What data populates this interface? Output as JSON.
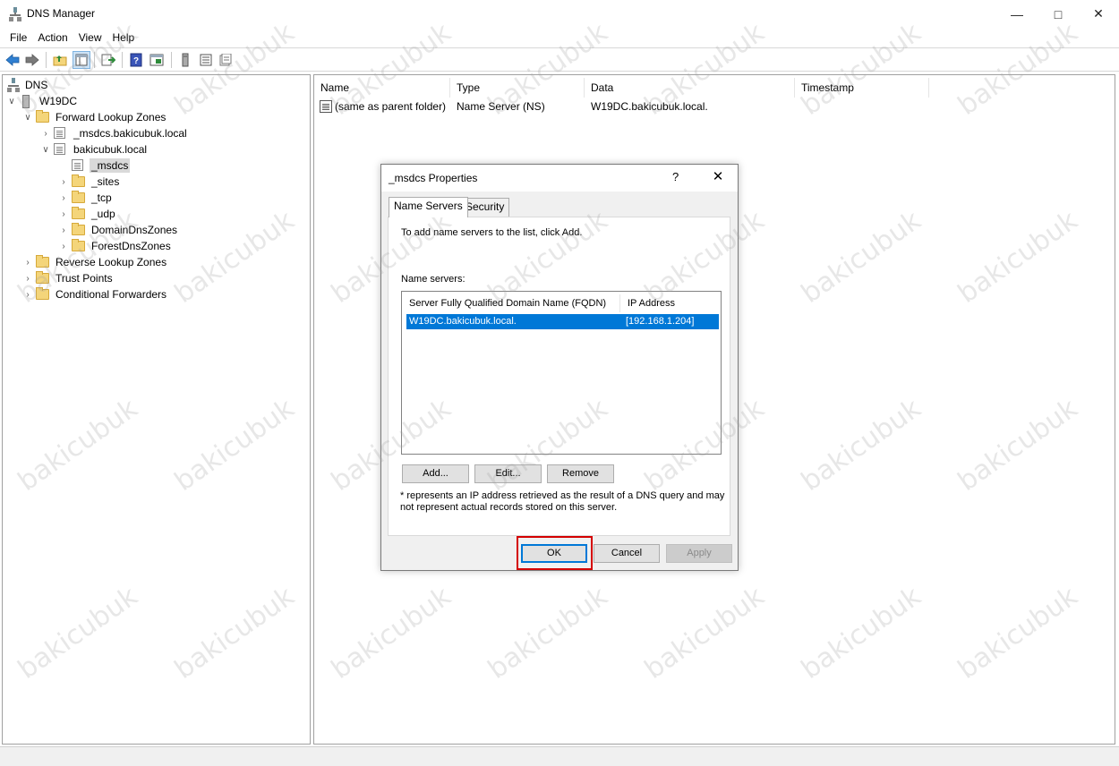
{
  "window": {
    "title": "DNS Manager"
  },
  "menu": [
    "File",
    "Action",
    "View",
    "Help"
  ],
  "toolbar": {
    "buttons": [
      "back-icon",
      "forward-icon",
      "up-folder-icon",
      "show-hide-tree-icon",
      "export-list-icon",
      "help-icon",
      "properties-icon",
      "server-icon",
      "list-icon",
      "record-icon"
    ]
  },
  "tree": {
    "root": "DNS",
    "server": "W19DC",
    "forward": "Forward Lookup Zones",
    "msdcs_zone": "_msdcs.bakicubuk.local",
    "domain_zone": "bakicubuk.local",
    "children": [
      "_msdcs",
      "_sites",
      "_tcp",
      "_udp",
      "DomainDnsZones",
      "ForestDnsZones"
    ],
    "reverse": "Reverse Lookup Zones",
    "trust": "Trust Points",
    "conditional": "Conditional Forwarders"
  },
  "list": {
    "columns": [
      "Name",
      "Type",
      "Data",
      "Timestamp"
    ],
    "rows": [
      {
        "name": "(same as parent folder)",
        "type": "Name Server (NS)",
        "data": "W19DC.bakicubuk.local.",
        "timestamp": ""
      }
    ]
  },
  "dialog": {
    "title": "_msdcs Properties",
    "help": "?",
    "close": "✕",
    "tabs": [
      "Name Servers",
      "Security"
    ],
    "instruction": "To add name servers to the list, click Add.",
    "ns_label": "Name servers:",
    "lv_columns": [
      "Server Fully Qualified Domain Name (FQDN)",
      "IP Address"
    ],
    "lv_rows": [
      {
        "fqdn": "W19DC.bakicubuk.local.",
        "ip": "[192.168.1.204]"
      }
    ],
    "add": "Add...",
    "edit": "Edit...",
    "remove": "Remove",
    "note_line1": "* represents an IP address retrieved as the result of a DNS query and may",
    "note_line2": "not represent actual records stored on this server.",
    "ok": "OK",
    "cancel": "Cancel",
    "apply": "Apply"
  },
  "watermark": "bakicubuk"
}
